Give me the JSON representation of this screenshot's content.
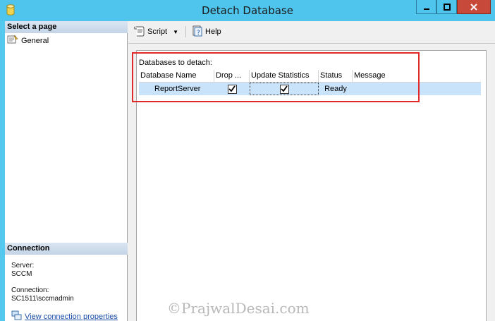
{
  "window": {
    "title": "Detach Database"
  },
  "left": {
    "select_page_header": "Select a page",
    "pages": [
      {
        "label": "General"
      }
    ],
    "connection_header": "Connection",
    "server_label": "Server:",
    "server_value": "SCCM",
    "connection_label": "Connection:",
    "connection_value": "SC1511\\sccmadmin",
    "view_link": "View connection properties"
  },
  "toolbar": {
    "script_label": "Script",
    "help_label": "Help"
  },
  "main": {
    "section_label": "Databases to detach:",
    "columns": [
      "Database Name",
      "Drop ...",
      "Update Statistics",
      "Status",
      "Message"
    ],
    "rows": [
      {
        "database_name": "ReportServer",
        "drop_connections": true,
        "update_statistics": true,
        "status": "Ready",
        "message": ""
      }
    ]
  },
  "watermark": "©PrajwalDesai.com",
  "colors": {
    "titlebar": "#4fc4ec",
    "row_selected": "#c9e3fa",
    "highlight_box": "#e02a2a"
  },
  "icons": {
    "app": "database-icon",
    "page": "page-icon",
    "script": "script-icon",
    "help": "help-icon"
  }
}
